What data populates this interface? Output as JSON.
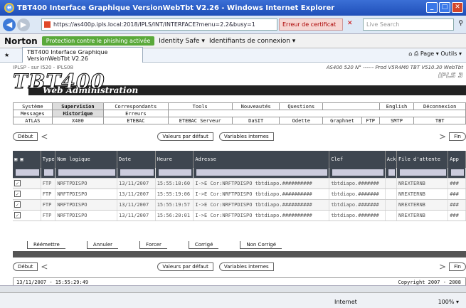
{
  "window": {
    "title": "TBT400 Interface Graphique VersionWebTbt V2.26 - Windows Internet Explorer"
  },
  "browser": {
    "url": "https://as400p.ipls.local:2018/IPLS/INT/INTERFACE?menu=2.2&busy=1",
    "cert_error": "Erreur de certificat",
    "search_placeholder": "Live Search",
    "tab_label": "TBT400 Interface Graphique VersionWebTbt V2.26",
    "norton": "Norton",
    "phishing": "Protection contre le phishing activée",
    "identity": "Identity Safe ▾",
    "login_ids": "Identifiants de connexion ▾",
    "page_menu": "Page ▾",
    "tools_menu": "Outils ▾"
  },
  "app": {
    "breadcrumb": "IPLSP - sur I520 - IPLS08",
    "server_info": "AS400 520 N° ------ Prod V5R4M0 TBT V510.30 WebTbt",
    "logo": "TBT400",
    "subtitle": "Web Administration",
    "ipls": "IPLS 3"
  },
  "menu": {
    "row1": [
      "Système",
      "Supervision",
      "Correspondants",
      "Tools",
      "Nouveautés",
      "Questions",
      "",
      "English",
      "Déconnexion"
    ],
    "row2": [
      "Messages",
      "Historique",
      "Erreurs",
      "",
      "",
      "",
      "",
      "",
      ""
    ],
    "row3": [
      "ATLAS",
      "X400",
      "ETEBAC",
      "ETEBAC Serveur",
      "DaSIT",
      "Odette",
      "Graphnet",
      "FTP",
      "SMTP",
      "TBT"
    ]
  },
  "nav": {
    "debut": "Début",
    "fin": "Fin",
    "valeurs": "Valeurs par défaut",
    "variables": "Variables internes"
  },
  "grid": {
    "headers": [
      "",
      "Type",
      "Nom logique",
      "Date",
      "Heure",
      "Adresse",
      "Clef",
      "Ack",
      "File d'attente",
      "App"
    ],
    "rows": [
      {
        "type": "FTP",
        "nom": "NRFTPDISPO",
        "date": "13/11/2007",
        "heure": "15:55:18:60",
        "adresse": "I->E Cor:NRFTPDISPO tbtdiapo.##########",
        "clef": "tbtdiapo.#######",
        "file": "NREXTERNB",
        "app": "###"
      },
      {
        "type": "FTP",
        "nom": "NRFTPDISPO",
        "date": "13/11/2007",
        "heure": "15:55:19:06",
        "adresse": "I->E Cor:NRFTPDISPO tbtdiapo.##########",
        "clef": "tbtdiapo.#######",
        "file": "NREXTERNB",
        "app": "###"
      },
      {
        "type": "FTP",
        "nom": "NRFTPDISPO",
        "date": "13/11/2007",
        "heure": "15:55:19:57",
        "adresse": "I->E Cor:NRFTPDISPO tbtdiapo.##########",
        "clef": "tbtdiapo.#######",
        "file": "NREXTERNB",
        "app": "###"
      },
      {
        "type": "FTP",
        "nom": "NRFTPDISPO",
        "date": "13/11/2007",
        "heure": "15:56:20:01",
        "adresse": "I->E Cor:NRFTPDISPO tbtdiapo.##########",
        "clef": "tbtdiapo.#######",
        "file": "NREXTERNB",
        "app": "###"
      }
    ]
  },
  "actions": [
    "Réémettre",
    "Annuler",
    "Forcer",
    "Corrigé",
    "Non Corrigé"
  ],
  "status": {
    "left": "13/11/2007 - 15:55:29:49",
    "right": "Copyright 2007 - 2008"
  },
  "footer": {
    "zone": "Internet",
    "zoom": "100% ▾"
  }
}
